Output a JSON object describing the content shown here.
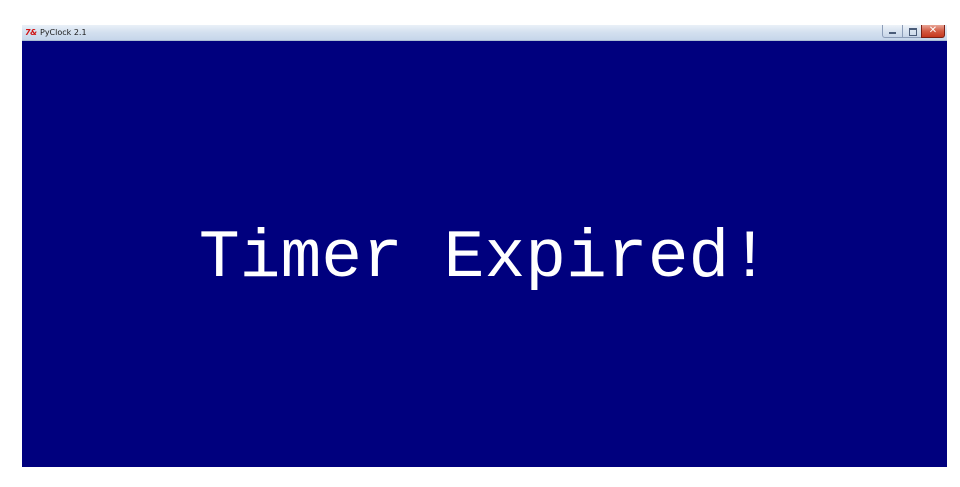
{
  "window": {
    "title": "PyClock 2.1",
    "icon": "tk-feather-icon",
    "controls": {
      "minimize": "minimize-icon",
      "maximize": "maximize-icon",
      "close_glyph": "✕"
    }
  },
  "canvas": {
    "background_color": "#00007e",
    "text_color": "#ffffff",
    "message": "Timer Expired!"
  }
}
